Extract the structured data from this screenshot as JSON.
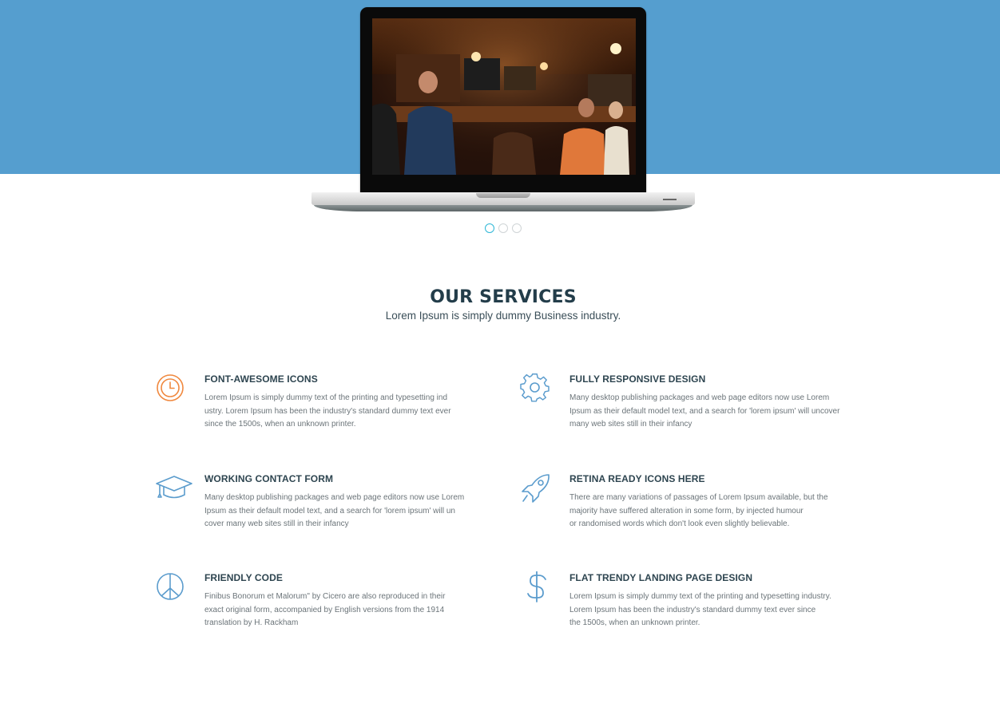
{
  "colors": {
    "hero_background": "#559ecf",
    "heading": "#233d4a",
    "icon_accent": "#f0883e",
    "icon_primary": "#5b9ccd",
    "active_dot": "#2db6d6"
  },
  "hero": {
    "image": "laptop-with-cafe-photo",
    "slider": {
      "total": 3,
      "active_index": 0
    }
  },
  "services": {
    "title": "OUR SERVICES",
    "subtitle": "Lorem Ipsum is simply dummy Business industry.",
    "items": [
      {
        "icon": "clock-icon",
        "title": "FONT-AWESOME ICONS",
        "description": "Lorem Ipsum is simply dummy text of the printing and typesetting ind\nustry. Lorem Ipsum has been the industry's standard dummy text ever\nsince the 1500s, when an unknown printer."
      },
      {
        "icon": "gear-icon",
        "title": "FULLY RESPONSIVE DESIGN",
        "description": "Many desktop publishing packages and web page editors now use Lorem\nIpsum as their default model text, and a search for 'lorem ipsum' will uncover\nmany web sites still in their infancy"
      },
      {
        "icon": "graduation-cap-icon",
        "title": "WORKING CONTACT FORM",
        "description": "Many desktop publishing packages and web page editors now use Lorem\nIpsum as their default model text, and a search for 'lorem ipsum' will un\ncover many web sites still in their infancy"
      },
      {
        "icon": "rocket-icon",
        "title": "RETINA READY ICONS HERE",
        "description": "There are many variations of passages of Lorem Ipsum available, but the\nmajority have suffered alteration in some form, by injected humour\nor randomised words which don't look even slightly believable."
      },
      {
        "icon": "peace-icon",
        "title": "FRIENDLY CODE",
        "description": "Finibus Bonorum et Malorum\" by Cicero are also reproduced in their\nexact original form, accompanied by English versions from the 1914\ntranslation by H. Rackham"
      },
      {
        "icon": "dollar-icon",
        "title": "FLAT TRENDY LANDING PAGE DESIGN",
        "description": "Lorem Ipsum is simply dummy text of the printing and typesetting industry.\nLorem Ipsum has been the industry's standard dummy text ever since\nthe 1500s, when an unknown printer."
      }
    ]
  }
}
